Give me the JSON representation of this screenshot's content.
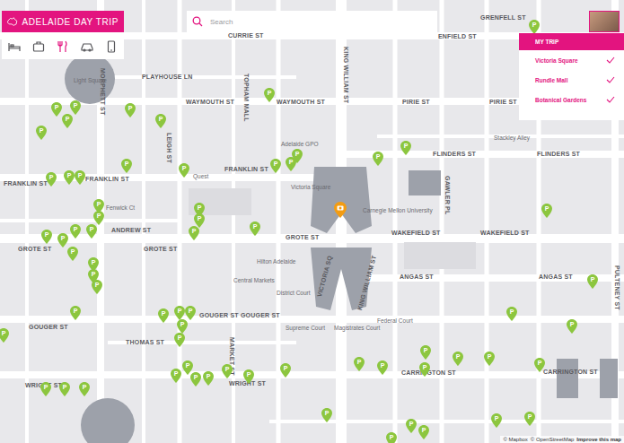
{
  "header": {
    "title": "ADELAIDE DAY TRIP"
  },
  "categories": [
    {
      "kind": "bed",
      "selected": false
    },
    {
      "kind": "luggage",
      "selected": false
    },
    {
      "kind": "food",
      "selected": true
    },
    {
      "kind": "car",
      "selected": false
    },
    {
      "kind": "phone",
      "selected": false
    }
  ],
  "search": {
    "placeholder": "Search"
  },
  "trip": {
    "title": "MY TRIP",
    "items": [
      {
        "name": "Victoria Square",
        "checked": true
      },
      {
        "name": "Rundle Mall",
        "checked": true
      },
      {
        "name": "Botanical Gardens",
        "checked": true
      }
    ]
  },
  "map": {
    "pin_label": "P",
    "street_labels": [
      "CURRIE ST",
      "ENFIELD ST",
      "GRENFELL ST",
      "PLAYHOUSE LN",
      "WAYMOUTH ST",
      "WAYMOUTH ST",
      "PIRIE ST",
      "PIRIE ST",
      "FRANKLIN ST",
      "FRANKLIN ST",
      "FRANKLIN ST",
      "FLINDERS ST",
      "FLINDERS ST",
      "ANDREW ST",
      "GROTE ST",
      "GROTE ST",
      "GROTE ST",
      "WAKEFIELD ST",
      "WAKEFIELD ST",
      "ANGAS ST",
      "ANGAS ST",
      "GOUGER ST",
      "GOUGER ST GOUGER ST",
      "THOMAS ST",
      "CARRINGTON ST",
      "CARRINGTON ST",
      "WRIGHT ST",
      "WRIGHT ST",
      "KING WILLIAM ST",
      "VICTORIA SQ",
      "KING WILLIAM ST",
      "MORPHETT ST",
      "LEIGH ST",
      "TOPHAM MALL",
      "GAWLER PL",
      "PULTENEY ST",
      "MARKET ST"
    ],
    "place_labels": [
      "Light Square",
      "Adelaide GPO",
      "Victoria Square",
      "Carnegie Mellon University",
      "Quest",
      "Hilton Adelaide",
      "Central Markets",
      "District Court",
      "Supreme Court",
      "Magistrates Court",
      "Federal Court",
      "Stackley Alley",
      "Fenwick Ct"
    ]
  },
  "attribution": [
    "© Mapbox",
    "© OpenStreetMap",
    "Improve this map"
  ]
}
